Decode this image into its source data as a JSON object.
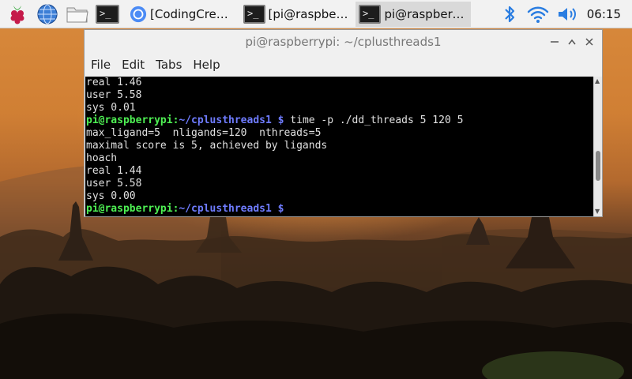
{
  "taskbar": {
    "launchers": [
      {
        "name": "raspberry-menu",
        "icon": "raspberry-icon"
      },
      {
        "name": "web-browser",
        "icon": "globe-icon"
      },
      {
        "name": "file-manager",
        "icon": "folder-icon"
      },
      {
        "name": "terminal",
        "icon": "terminal-icon"
      }
    ],
    "tasks": [
      {
        "label": "[CodingCrew3...",
        "icon": "chromium-icon"
      },
      {
        "label": "[pi@raspberry...",
        "icon": "terminal-icon"
      },
      {
        "label": "pi@raspberry...",
        "icon": "terminal-icon"
      }
    ],
    "tray": {
      "bluetooth_icon": "bluetooth-icon",
      "wifi_icon": "wifi-icon",
      "volume_icon": "volume-icon",
      "clock": "06:15"
    }
  },
  "window": {
    "title": "pi@raspberrypi: ~/cplusthreads1",
    "menu": [
      "File",
      "Edit",
      "Tabs",
      "Help"
    ],
    "terminal": {
      "prompt_user": "pi@raspberrypi",
      "prompt_sep": ":",
      "prompt_path": "~/cplusthreads1 $",
      "lines": [
        {
          "type": "out",
          "text": "real 1.46"
        },
        {
          "type": "out",
          "text": "user 5.58"
        },
        {
          "type": "out",
          "text": "sys 0.01"
        },
        {
          "type": "cmd",
          "text": " time -p ./dd_threads 5 120 5"
        },
        {
          "type": "out",
          "text": "max_ligand=5  nligands=120  nthreads=5"
        },
        {
          "type": "out",
          "text": "maximal score is 5, achieved by ligands"
        },
        {
          "type": "out",
          "text": "hoach"
        },
        {
          "type": "out",
          "text": "real 1.44"
        },
        {
          "type": "out",
          "text": "user 5.58"
        },
        {
          "type": "out",
          "text": "sys 0.00"
        },
        {
          "type": "cmd",
          "text": " "
        }
      ]
    }
  }
}
